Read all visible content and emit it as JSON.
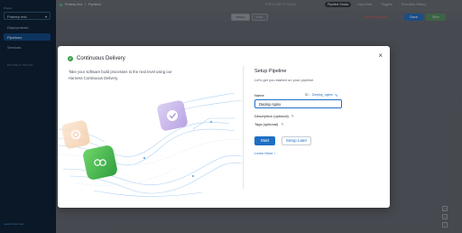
{
  "sidebar": {
    "project_label": "Project",
    "project_value": "Prateep test",
    "items": [
      {
        "label": "Deployments"
      },
      {
        "label": "Pipelines"
      },
      {
        "label": "Services"
      }
    ],
    "section_label": "PROJECT SETUP",
    "bottom_link": "Launch First Gen"
  },
  "header": {
    "breadcrumb_project": "Prateep test",
    "breadcrumb_sep": "/",
    "breadcrumb_page": "Pipelines",
    "studio_label": "PIPELINE STUDIO",
    "tabs": [
      {
        "label": "Pipeline Studio"
      },
      {
        "label": "Input Sets"
      },
      {
        "label": "Triggers"
      },
      {
        "label": "Execution History"
      }
    ]
  },
  "toolbar": {
    "view_visual": "VISUAL",
    "view_yaml": "YAML",
    "unsaved": "Unsaved changes",
    "save_label": "Save",
    "run_label": "Run"
  },
  "modal": {
    "title": "Continuous Delivery",
    "description": "Take your software build processes to the next level using our Harness Continuous Delivery.",
    "setup_title": "Setup Pipeline",
    "setup_subtitle": "Let's get you started on your pipeline.",
    "name_label": "Name",
    "id_label": "ID :",
    "id_value": "Deploy_nginx",
    "name_value": "Deploy nginx",
    "description_label": "Description (optional)",
    "tags_label": "Tags (optional)",
    "start_label": "Start",
    "setup_later_label": "Setup Later",
    "learn_more_label": "Learn More ›",
    "close_glyph": "×"
  },
  "icons": {
    "close": "close-icon",
    "check": "check-circle-icon",
    "edit": "pencil-icon"
  },
  "colors": {
    "brand_blue": "#1f6fc4",
    "success_green": "#3fa34d",
    "sidebar_bg": "#07182b"
  }
}
